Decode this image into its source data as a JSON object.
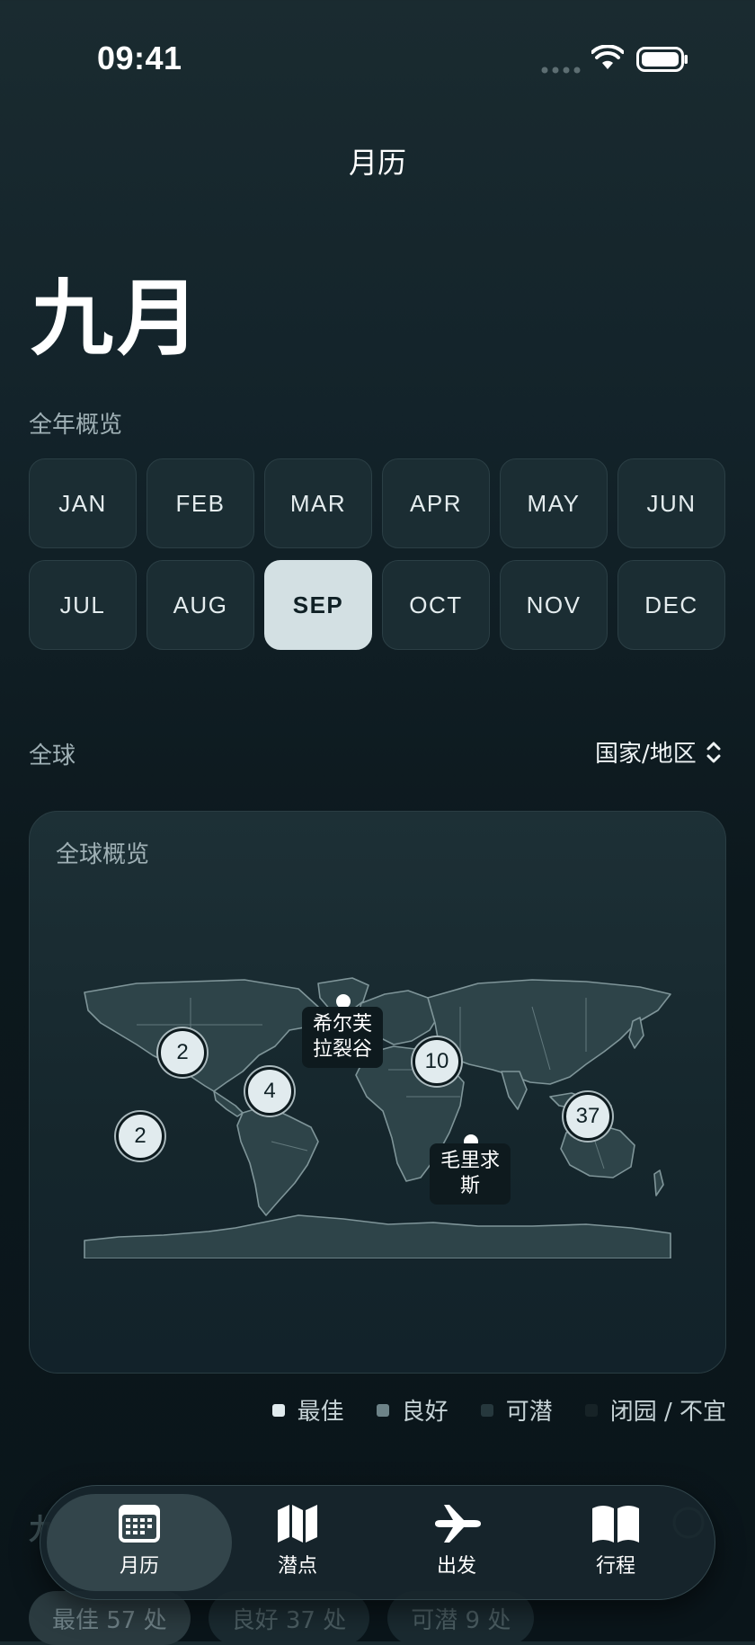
{
  "status_bar": {
    "time": "09:41"
  },
  "header": {
    "title": "月历"
  },
  "current_month": "九月",
  "overview": {
    "label": "全年概览",
    "months": [
      "JAN",
      "FEB",
      "MAR",
      "APR",
      "MAY",
      "JUN",
      "JUL",
      "AUG",
      "SEP",
      "OCT",
      "NOV",
      "DEC"
    ],
    "selected": "SEP"
  },
  "region": {
    "label": "全球",
    "picker_label": "国家/地区"
  },
  "map": {
    "title": "全球概览",
    "clusters": [
      "2",
      "4",
      "2",
      "10",
      "37"
    ],
    "labels": {
      "iceland": "希尔芙拉裂谷",
      "mauritius": "毛里求斯"
    }
  },
  "legend": {
    "items": [
      {
        "label": "最佳",
        "color": "#e1ebee"
      },
      {
        "label": "良好",
        "color": "#6d8388"
      },
      {
        "label": "可潜",
        "color": "#26383d"
      },
      {
        "label": "闭园 / 不宜",
        "color": "#172327"
      }
    ]
  },
  "below": {
    "title": "九月",
    "chips": [
      "最佳 57 处",
      "良好 37 处",
      "可潜 9 处"
    ]
  },
  "tabbar": {
    "tabs": [
      {
        "label": "月历",
        "icon": "calendar-icon",
        "active": true
      },
      {
        "label": "潜点",
        "icon": "map-icon",
        "active": false
      },
      {
        "label": "出发",
        "icon": "airplane-icon",
        "active": false
      },
      {
        "label": "行程",
        "icon": "book-icon",
        "active": false
      }
    ]
  }
}
